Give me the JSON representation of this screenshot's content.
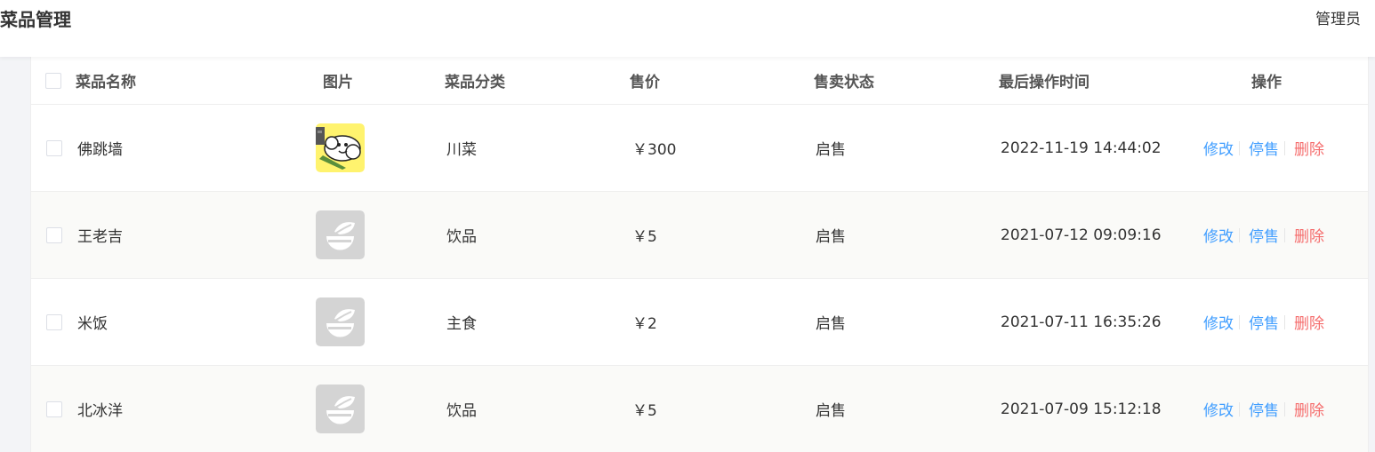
{
  "header": {
    "title": "菜品管理",
    "user": "管理员"
  },
  "table": {
    "columns": {
      "name": "菜品名称",
      "image": "图片",
      "category": "菜品分类",
      "price": "售价",
      "status": "售卖状态",
      "updated": "最后操作时间",
      "actions": "操作"
    },
    "actions": {
      "edit": "修改",
      "toggle": "停售",
      "delete": "删除"
    },
    "rows": [
      {
        "name": "佛跳墙",
        "image": "dish-photo",
        "category": "川菜",
        "price": "￥300",
        "status": "启售",
        "updated": "2022-11-19 14:44:02"
      },
      {
        "name": "王老吉",
        "image": "placeholder-icon",
        "category": "饮品",
        "price": "￥5",
        "status": "启售",
        "updated": "2021-07-12 09:09:16"
      },
      {
        "name": "米饭",
        "image": "placeholder-icon",
        "category": "主食",
        "price": "￥2",
        "status": "启售",
        "updated": "2021-07-11 16:35:26"
      },
      {
        "name": "北冰洋",
        "image": "placeholder-icon",
        "category": "饮品",
        "price": "￥5",
        "status": "启售",
        "updated": "2021-07-09 15:12:18"
      }
    ]
  },
  "colors": {
    "link_blue": "#419eff",
    "link_red": "#f56c6c",
    "placeholder_gray": "#d4d4d4",
    "photo_yellow": "#fff36e"
  }
}
